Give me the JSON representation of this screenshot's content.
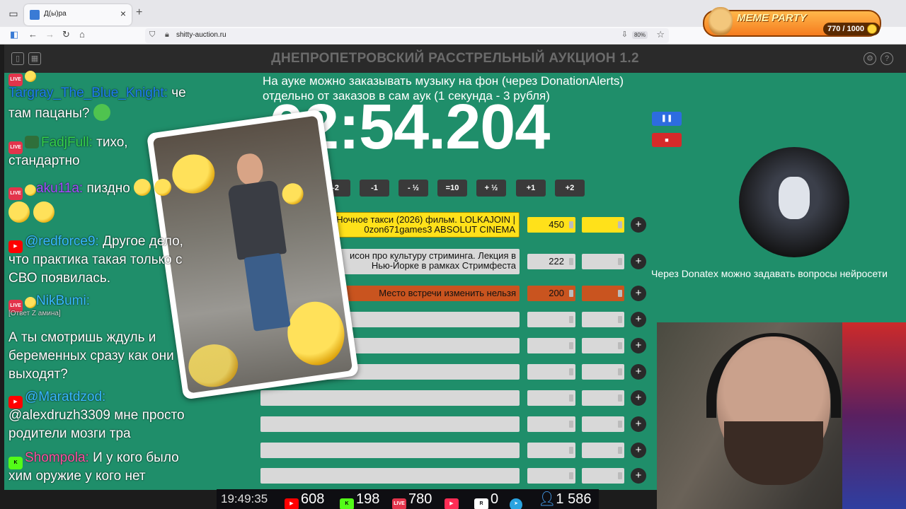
{
  "browser": {
    "tab_title": "Д(ы)ра",
    "url": "shitty-auction.ru",
    "zoom": "80%"
  },
  "overlay": {
    "meme_title": "MEME PARTY",
    "meme_count": "770 / 1000"
  },
  "page": {
    "title": "ДНЕПРОПЕТРОВСКИЙ РАССТРЕЛЬНЫЙ АУКЦИОН 1.2",
    "notice_line1": "На ауке можно заказывать музыку на фон (через DonationAlerts)",
    "notice_line2": "отдельно от заказов в сам аук (1 секунда - 3 рубля)",
    "timer": "02:54.204",
    "adjust_buttons": [
      "-2",
      "-1",
      "- ½",
      "=10",
      "+ ½",
      "+1",
      "+2"
    ],
    "donatex": "Через Donatex можно задавать вопросы нейросети"
  },
  "lots": [
    {
      "title_l1": "Ночное такси (2026) фильм. LOLKAJOIN |",
      "title_l2": "0zon671games3 ABSOLUT CINEMA",
      "value": "450"
    },
    {
      "title_l1": "исон про культуру стриминга. Лекция в",
      "title_l2": "Нью-Йорке в рамках Стримфеста",
      "value": "222"
    },
    {
      "title_l1": "Место встречи изменить нельзя",
      "title_l2": "",
      "value": "200"
    }
  ],
  "chat": {
    "m1_user": "Targray_The_Blue_Knight:",
    "m1_text": " че",
    "m1_text2": "там пацаны?",
    "m2_user": "FadjFull:",
    "m2_text": " тихо,",
    "m2_text2": "стандартно",
    "m3_user": "aku11a:",
    "m3_text": " пиздно",
    "m4_user": "@redforce9:",
    "m4_text": " Другое дело,",
    "m4_text2": "что практика такая только с",
    "m4_text3": "СВО появилась.",
    "m5_user": "NikBumi:",
    "m5_reply": "[Ответ Z амина]",
    "m5_text": "А ты смотришь ждуль и",
    "m5_text2": "беременных сразу как они",
    "m5_text3": "выходят?",
    "m6_user": "@Maratdzod:",
    "m6_text": "@alexdruzh3309 мне просто",
    "m6_text2": "родители мозги тра",
    "m7_user": "Shompola:",
    "m7_text": " И у кого было",
    "m7_text2": "хим оружие у кого нет"
  },
  "stats": {
    "time": "19:49:35",
    "youtube": "608",
    "kick": "198",
    "live": "780",
    "rutube": "0",
    "viewers": "1 586"
  },
  "colors": {
    "page_bg": "#1f8e6a",
    "lot_1": "#ffe11a",
    "lot_3": "#c9541f"
  }
}
